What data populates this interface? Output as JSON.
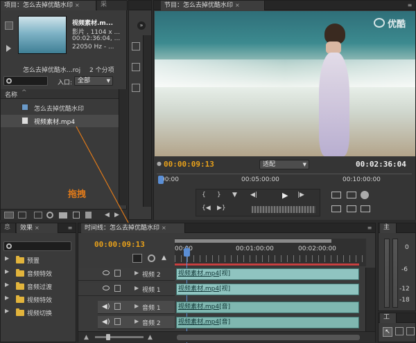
{
  "project": {
    "tab_title": "项目：怎么去掉优酷水印",
    "tab_second": "采",
    "clip_name": "视频素材.m...",
    "clip_type": "影片 , 1104 x ...",
    "clip_duration": "00:02:36:04, ...",
    "clip_audio": "22050 Hz - ...",
    "project_file": "怎么去掉优酷水...roj",
    "item_count": "2 个分项",
    "search_placeholder": "",
    "entry_label": "入口:",
    "entry_value": "全部",
    "name_header": "名称",
    "items": [
      {
        "label": "怎么去掉优酷水印"
      },
      {
        "label": "视频素材.mp4"
      }
    ]
  },
  "source_strip": {
    "icons": [
      "fx-icon",
      "audio-icon",
      "mixer-icon"
    ]
  },
  "program": {
    "tab_title": "节目：怎么去掉优酷水印",
    "watermark": "优酷",
    "current_time": "00:00:09:13",
    "fit_label": "适配",
    "duration": "00:02:36:04",
    "ruler_labels": [
      "00:00",
      "00:05:00:00",
      "00:10:00:00"
    ]
  },
  "annotation": {
    "drag_label": "拖拽"
  },
  "effects": {
    "tab_info": "息",
    "tab_effects": "效果",
    "search_placeholder": "",
    "folders": [
      {
        "label": "预置"
      },
      {
        "label": "音频特效"
      },
      {
        "label": "音频过渡"
      },
      {
        "label": "视频特效"
      },
      {
        "label": "视频切换"
      }
    ]
  },
  "timeline": {
    "tab_title": "时间线：怎么去掉优酷水印",
    "current_time": "00:00:09:13",
    "ruler_labels": [
      "00:00",
      "00:01:00:00",
      "00:02:00:00"
    ],
    "tracks": [
      {
        "name": "视频 2",
        "kind": "video",
        "clip_file": "视频素材.mp4",
        "clip_tag": "[视]"
      },
      {
        "name": "视频 1",
        "kind": "video",
        "clip_file": "视频素材.mp4",
        "clip_tag": "[视]"
      },
      {
        "name": "音频 1",
        "kind": "audio",
        "clip_file": "视频素材.mp4",
        "clip_tag": "[音]"
      },
      {
        "name": "音频 2",
        "kind": "audio",
        "clip_file": "视频素材.mp4",
        "clip_tag": "[音]"
      }
    ]
  },
  "audio_meter": {
    "tab": "主",
    "scale": [
      "0",
      "-6",
      "-12",
      "-18"
    ]
  },
  "tools": {
    "tab": "工"
  },
  "colors": {
    "timecode": "#e8a11b",
    "clip": "#8fc4c0",
    "folder": "#e2b43c",
    "annotation": "#e07a1a"
  }
}
